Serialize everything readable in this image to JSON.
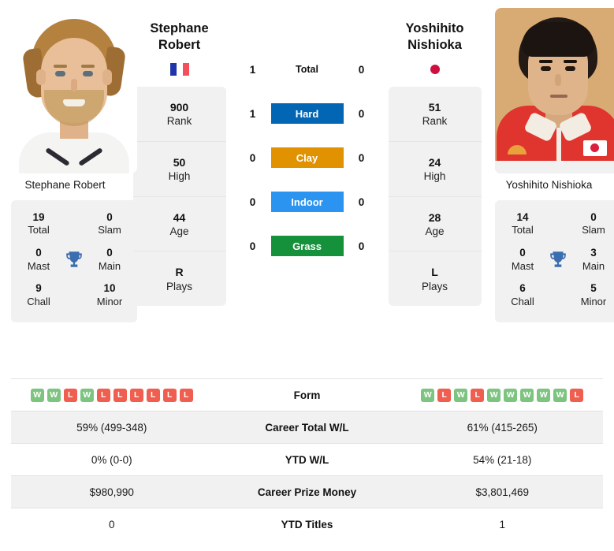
{
  "players": {
    "left": {
      "name_line1": "Stephane",
      "name_line2": "Robert",
      "full_name": "Stephane Robert",
      "country_flag": "flag-france-icon",
      "photo_caption": "Stephane Robert",
      "info": [
        {
          "value": "900",
          "label": "Rank"
        },
        {
          "value": "50",
          "label": "High"
        },
        {
          "value": "44",
          "label": "Age"
        },
        {
          "value": "R",
          "label": "Plays"
        }
      ],
      "titles": {
        "total": "19",
        "total_label": "Total",
        "slam": "0",
        "slam_label": "Slam",
        "mast": "0",
        "mast_label": "Mast",
        "main": "0",
        "main_label": "Main",
        "chall": "9",
        "chall_label": "Chall",
        "minor": "10",
        "minor_label": "Minor"
      },
      "form": [
        "W",
        "W",
        "L",
        "W",
        "L",
        "L",
        "L",
        "L",
        "L",
        "L"
      ],
      "career_total_wl": "59% (499-348)",
      "ytd_wl": "0% (0-0)",
      "career_prize_money": "$980,990",
      "ytd_titles": "0"
    },
    "right": {
      "name_line1": "Yoshihito",
      "name_line2": "Nishioka",
      "full_name": "Yoshihito Nishioka",
      "country_flag": "flag-japan-icon",
      "photo_caption": "Yoshihito Nishioka",
      "info": [
        {
          "value": "51",
          "label": "Rank"
        },
        {
          "value": "24",
          "label": "High"
        },
        {
          "value": "28",
          "label": "Age"
        },
        {
          "value": "L",
          "label": "Plays"
        }
      ],
      "titles": {
        "total": "14",
        "total_label": "Total",
        "slam": "0",
        "slam_label": "Slam",
        "mast": "0",
        "mast_label": "Mast",
        "main": "3",
        "main_label": "Main",
        "chall": "6",
        "chall_label": "Chall",
        "minor": "5",
        "minor_label": "Minor"
      },
      "form": [
        "W",
        "L",
        "W",
        "L",
        "W",
        "W",
        "W",
        "W",
        "W",
        "L"
      ],
      "career_total_wl": "61% (415-265)",
      "ytd_wl": "54% (21-18)",
      "career_prize_money": "$3,801,469",
      "ytd_titles": "1"
    }
  },
  "head_to_head": [
    {
      "label": "Total",
      "left": "1",
      "right": "0",
      "style": "plain",
      "color": ""
    },
    {
      "label": "Hard",
      "left": "1",
      "right": "0",
      "style": "chip",
      "color": "#0366b5"
    },
    {
      "label": "Clay",
      "left": "0",
      "right": "0",
      "style": "chip",
      "color": "#e09200"
    },
    {
      "label": "Indoor",
      "left": "0",
      "right": "0",
      "style": "chip",
      "color": "#2b94f0"
    },
    {
      "label": "Grass",
      "left": "0",
      "right": "0",
      "style": "chip",
      "color": "#16913b"
    }
  ],
  "stats_table": [
    {
      "key": "form",
      "label": "Form",
      "left": "",
      "right": "",
      "alt": false
    },
    {
      "key": "ctwl",
      "label": "Career Total W/L",
      "left": "59% (499-348)",
      "right": "61% (415-265)",
      "alt": true
    },
    {
      "key": "ytdwl",
      "label": "YTD W/L",
      "left": "0% (0-0)",
      "right": "54% (21-18)",
      "alt": false
    },
    {
      "key": "cpm",
      "label": "Career Prize Money",
      "left": "$980,990",
      "right": "$3,801,469",
      "alt": true
    },
    {
      "key": "ytdt",
      "label": "YTD Titles",
      "left": "0",
      "right": "1",
      "alt": false
    }
  ],
  "colors": {
    "hard": "#0366b5",
    "clay": "#e09200",
    "indoor": "#2b94f0",
    "grass": "#16913b",
    "win_badge": "#7cc47f",
    "loss_badge": "#ef5e4e",
    "trophy": "#3a6eb0",
    "card_bg": "#f1f1f1"
  }
}
